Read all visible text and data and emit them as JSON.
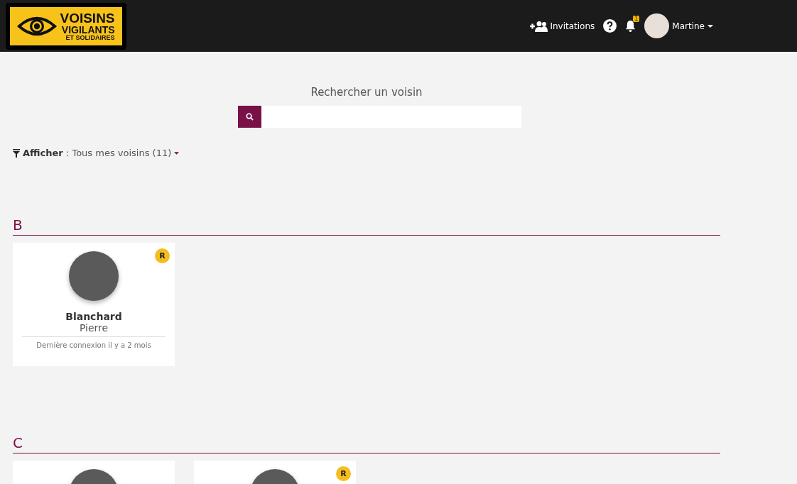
{
  "header": {
    "logo": {
      "lines": [
        "VOISINS",
        "VIGILANTS",
        "ET SOLIDAIRES"
      ]
    },
    "invitations": "Invitations",
    "notifications": {
      "count": "1"
    },
    "user": {
      "name": "Martine"
    }
  },
  "search": {
    "title": "Rechercher un voisin"
  },
  "filter": {
    "text": "**Afficher** : Tous mes voisins (11)"
  },
  "sections": [
    {
      "letter": "B",
      "cards": [
        {
          "photo": true,
          "last_name": "Blanchard",
          "first_name": "Pierre",
          "last_login": "Dernière connexion il y a 2 mois",
          "badge": "R"
        }
      ]
    },
    {
      "letter": "C",
      "cards": [
        {
          "photo": true
        },
        {
          "photo": true,
          "badge": "R"
        }
      ]
    }
  ]
}
